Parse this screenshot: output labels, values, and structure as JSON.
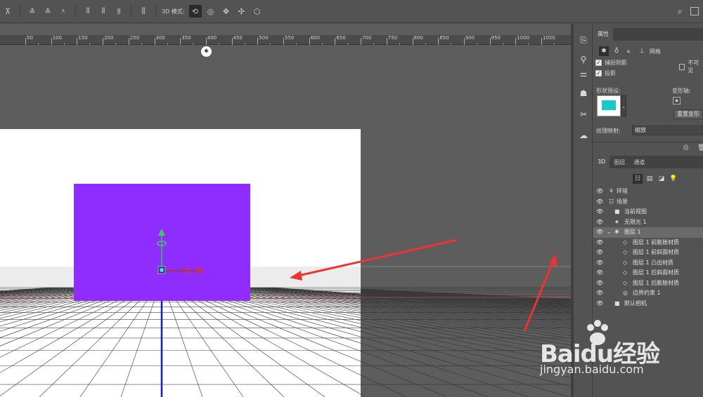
{
  "toolbar": {
    "mode_label": "3D 模式:",
    "search_icon": "search-icon"
  },
  "ruler": {
    "ticks": [
      "50",
      "100",
      "150",
      "200",
      "250",
      "300",
      "350",
      "400",
      "450",
      "500",
      "550",
      "600",
      "650",
      "700",
      "750",
      "800",
      "850",
      "900",
      "950",
      "1000",
      "1050"
    ]
  },
  "properties": {
    "tab": "属性",
    "mesh_label": "网格",
    "catch_shadow": "捕捉阴影",
    "invisible": "不可见",
    "cast_shadow": "投影",
    "shape_preset": "形状预设:",
    "deform_axis": "变形轴:",
    "reset_deform": "重置变形",
    "texture_map": "纹理映射:",
    "texture_value": "缩放"
  },
  "panel3d": {
    "tabs": [
      "3D",
      "图层",
      "通道"
    ],
    "items": [
      {
        "label": "环境"
      },
      {
        "label": "场景"
      },
      {
        "label": "当前视图"
      },
      {
        "label": "无限光 1"
      },
      {
        "label": "图层 1"
      },
      {
        "label": "图层 1 前膨胀材质"
      },
      {
        "label": "图层 1 前斜面材质"
      },
      {
        "label": "图层 1 凸出材质"
      },
      {
        "label": "图层 1 后斜面材质"
      },
      {
        "label": "图层 1 后膨胀材质"
      },
      {
        "label": "边界约束 1"
      },
      {
        "label": "默认相机"
      }
    ]
  },
  "watermark": {
    "brand": "Baidu经验",
    "url": "jingyan.baidu.com"
  },
  "colors": {
    "mesh_front": "#8f2cff",
    "preset_swatch": "#17c9c9",
    "annotation_arrow": "#ee3333"
  }
}
